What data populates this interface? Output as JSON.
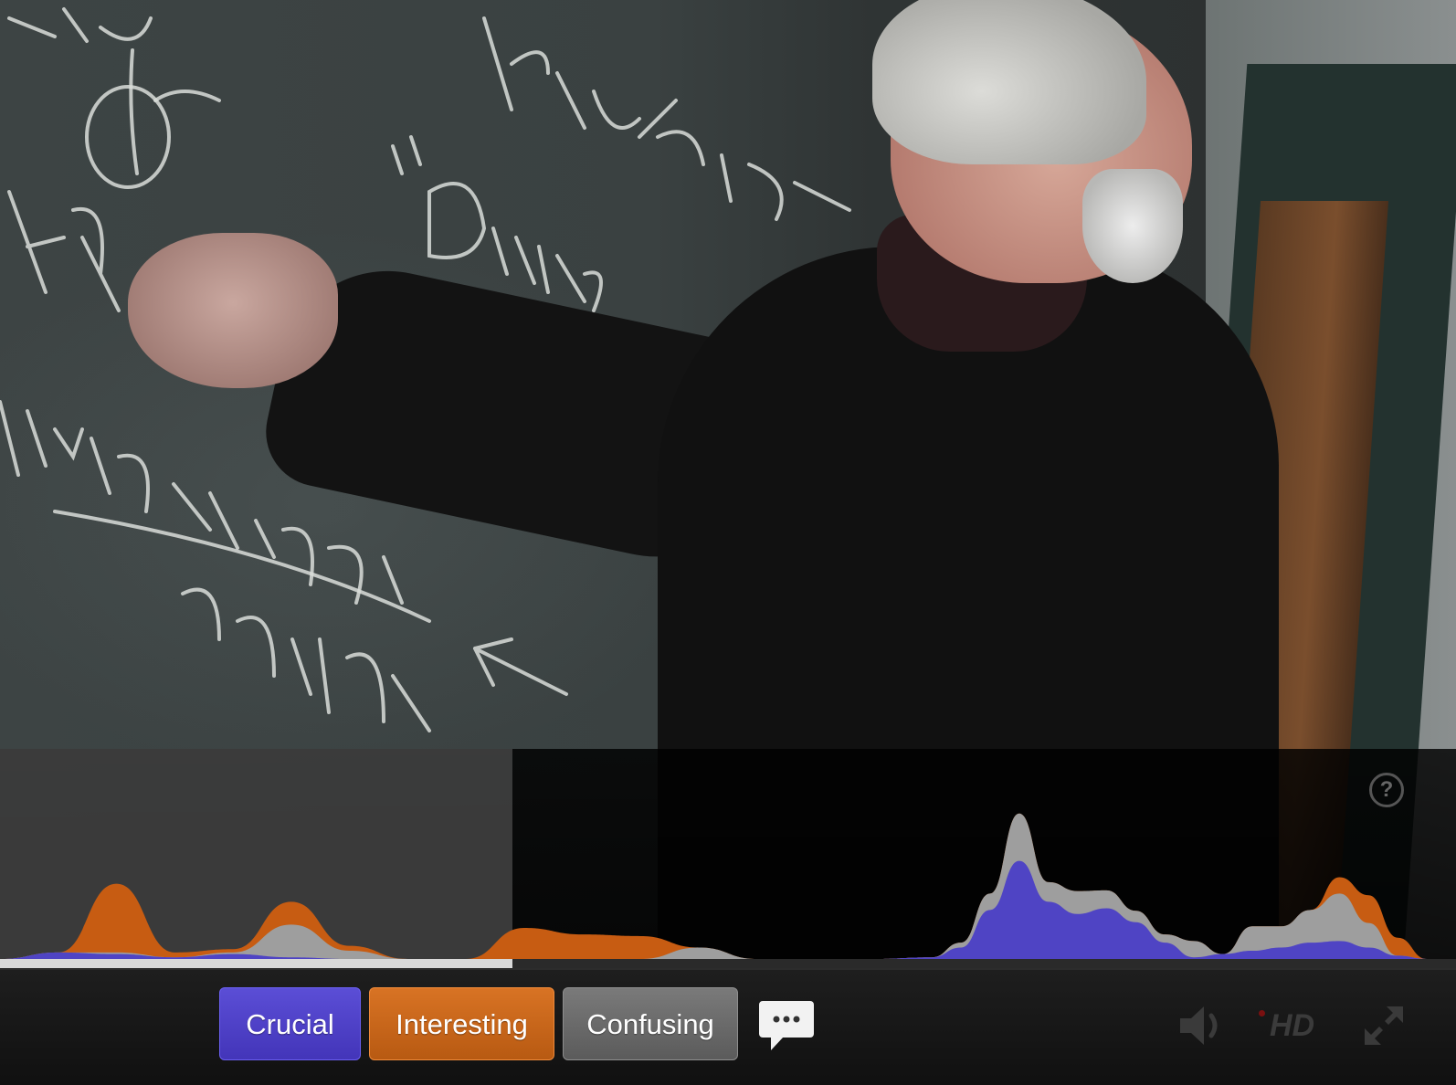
{
  "rating_buttons": {
    "crucial_label": "Crucial",
    "interesting_label": "Interesting",
    "confusing_label": "Confusing"
  },
  "help": {
    "label": "?"
  },
  "hd": {
    "label": "HD"
  },
  "playback": {
    "progress_fraction": 0.352
  },
  "colors": {
    "crucial": "#4f44c4",
    "interesting": "#c75c12",
    "confusing": "#9e9e9e"
  },
  "icons": [
    "comment-bubble-icon",
    "volume-icon",
    "hd-icon",
    "fullscreen-icon",
    "help-icon"
  ],
  "chart_data": {
    "type": "area",
    "series": [
      {
        "name": "Crucial",
        "color": "#4f44c4",
        "x": [
          0.0,
          0.04,
          0.08,
          0.12,
          0.16,
          0.2,
          0.24,
          0.28,
          0.32,
          0.36,
          0.4,
          0.44,
          0.48,
          0.52,
          0.56,
          0.6,
          0.64,
          0.66,
          0.68,
          0.7,
          0.72,
          0.74,
          0.76,
          0.78,
          0.8,
          0.82,
          0.84,
          0.86,
          0.88,
          0.9,
          0.92,
          0.94,
          0.96,
          0.98,
          1.0
        ],
        "values": [
          0,
          8,
          6,
          2,
          6,
          2,
          0,
          0,
          0,
          0,
          0,
          0,
          0,
          0,
          0,
          0,
          2,
          14,
          60,
          120,
          70,
          55,
          62,
          45,
          20,
          2,
          6,
          10,
          14,
          20,
          22,
          14,
          4,
          0,
          0
        ]
      },
      {
        "name": "Confusing",
        "color": "#9e9e9e",
        "x": [
          0.0,
          0.04,
          0.08,
          0.12,
          0.16,
          0.2,
          0.24,
          0.28,
          0.32,
          0.36,
          0.4,
          0.44,
          0.48,
          0.52,
          0.56,
          0.6,
          0.64,
          0.66,
          0.68,
          0.7,
          0.72,
          0.74,
          0.76,
          0.78,
          0.8,
          0.82,
          0.84,
          0.86,
          0.88,
          0.9,
          0.92,
          0.94,
          0.96,
          0.98,
          1.0
        ],
        "values": [
          0,
          0,
          2,
          0,
          2,
          40,
          10,
          0,
          0,
          0,
          0,
          0,
          14,
          0,
          0,
          0,
          0,
          6,
          20,
          58,
          24,
          28,
          22,
          14,
          10,
          20,
          0,
          30,
          26,
          40,
          58,
          30,
          0,
          0,
          0
        ]
      },
      {
        "name": "Interesting",
        "color": "#c75c12",
        "x": [
          0.0,
          0.04,
          0.08,
          0.12,
          0.16,
          0.2,
          0.24,
          0.28,
          0.32,
          0.36,
          0.4,
          0.44,
          0.48,
          0.52,
          0.56,
          0.6,
          0.64,
          0.66,
          0.68,
          0.7,
          0.72,
          0.74,
          0.76,
          0.78,
          0.8,
          0.82,
          0.84,
          0.86,
          0.88,
          0.9,
          0.92,
          0.94,
          0.96,
          0.98,
          1.0
        ],
        "values": [
          0,
          0,
          84,
          6,
          4,
          28,
          6,
          0,
          0,
          38,
          30,
          28,
          0,
          0,
          0,
          0,
          0,
          0,
          0,
          0,
          0,
          0,
          0,
          0,
          0,
          0,
          0,
          0,
          0,
          0,
          20,
          34,
          22,
          0,
          0
        ]
      }
    ],
    "ylim": [
      0,
      190
    ]
  }
}
